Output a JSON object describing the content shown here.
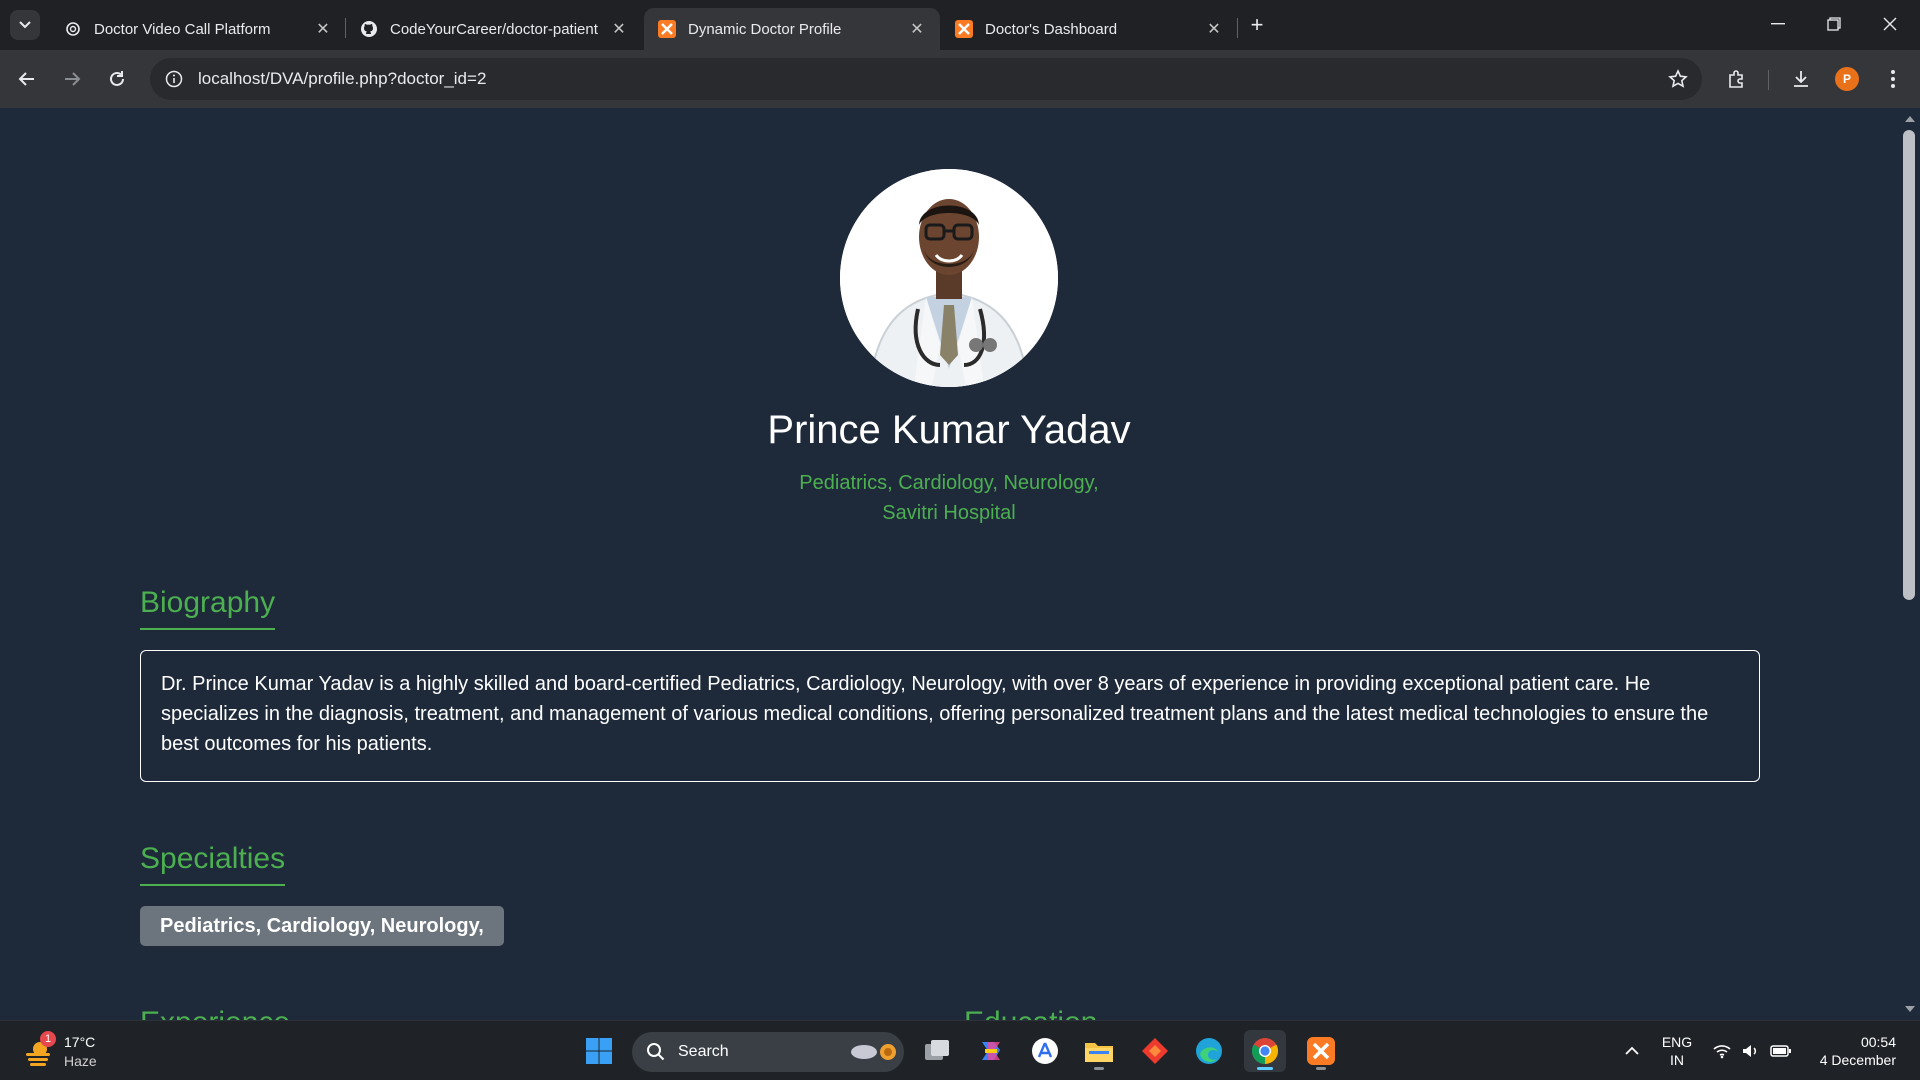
{
  "browser": {
    "tabs": [
      {
        "title": "Doctor Video Call Platform",
        "icon": "openai-icon",
        "active": false
      },
      {
        "title": "CodeYourCareer/doctor-patient",
        "icon": "github-icon",
        "active": false
      },
      {
        "title": "Dynamic Doctor Profile",
        "icon": "xampp-icon",
        "active": true
      },
      {
        "title": "Doctor's Dashboard",
        "icon": "xampp-icon",
        "active": false
      }
    ],
    "url": "localhost/DVA/profile.php?doctor_id=2",
    "profile_initial": "P",
    "colors": {
      "tabbar": "#202124",
      "toolbar": "#35363a",
      "avatar": "#e8711a"
    }
  },
  "profile": {
    "name": "Prince Kumar Yadav",
    "specialties_line": "Pediatrics, Cardiology, Neurology,",
    "hospital": "Savitri Hospital",
    "photo_alt": "doctor-photo"
  },
  "biography": {
    "title": "Biography",
    "text": "Dr. Prince Kumar Yadav is a highly skilled and board-certified Pediatrics, Cardiology, Neurology, with over 8 years of experience in providing exceptional patient care. He specializes in the diagnosis, treatment, and management of various medical conditions, offering personalized treatment plans and the latest medical technologies to ensure the best outcomes for his patients."
  },
  "specialties": {
    "title": "Specialties",
    "badge": "Pediatrics, Cardiology, Neurology,"
  },
  "sections_below": {
    "experience_title": "Experience",
    "education_title": "Education"
  },
  "theme": {
    "background": "#1e2a3a",
    "accent": "#4caf50",
    "badge": "#6c757d"
  },
  "taskbar": {
    "weather_temp": "17°C",
    "weather_desc": "Haze",
    "weather_badge": "1",
    "search_label": "Search",
    "lang_top": "ENG",
    "lang_bottom": "IN",
    "time": "00:54",
    "date": "4 December"
  }
}
